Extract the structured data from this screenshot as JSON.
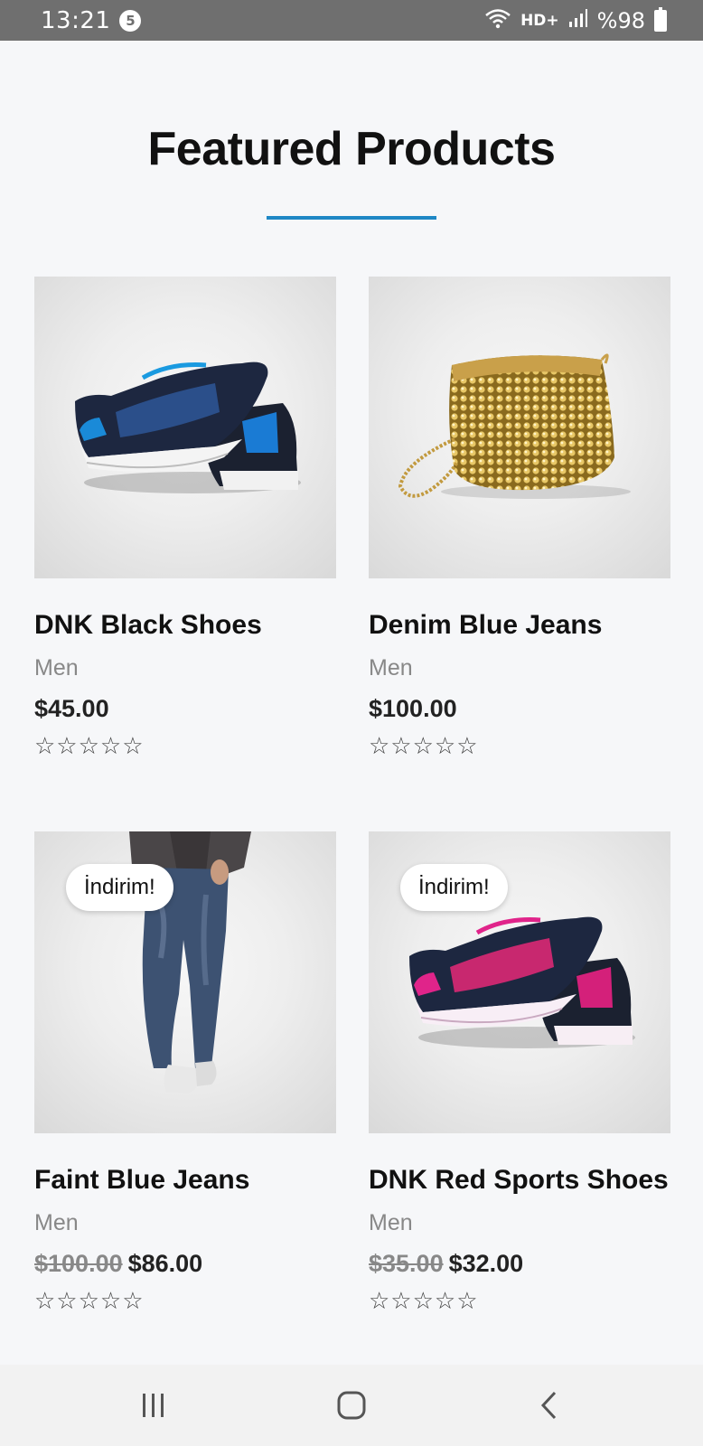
{
  "status_bar": {
    "time": "13:21",
    "notification_count": "5",
    "network_label": "HD+",
    "battery": "%98"
  },
  "page": {
    "title": "Featured Products",
    "accent_color": "#1e87c5"
  },
  "products": [
    {
      "name": "DNK Black Shoes",
      "category": "Men",
      "price": "$45.00",
      "old_price": "",
      "badge": "",
      "rating_stars": "☆☆☆☆☆",
      "image": "blue-black-sneakers"
    },
    {
      "name": "Denim Blue Jeans",
      "category": "Men",
      "price": "$100.00",
      "old_price": "",
      "badge": "",
      "rating_stars": "☆☆☆☆☆",
      "image": "gold-sequin-handbag"
    },
    {
      "name": "Faint Blue Jeans",
      "category": "Men",
      "price": "$86.00",
      "old_price": "$100.00",
      "badge": "İndirim!",
      "rating_stars": "☆☆☆☆☆",
      "image": "man-in-jeans"
    },
    {
      "name": "DNK Red Sports Shoes",
      "category": "Men",
      "price": "$32.00",
      "old_price": "$35.00",
      "badge": "İndirim!",
      "rating_stars": "☆☆☆☆☆",
      "image": "pink-black-sneakers"
    }
  ],
  "nav_bar": {
    "recents_icon": "recents-icon",
    "home_icon": "home-icon",
    "back_icon": "back-icon"
  }
}
